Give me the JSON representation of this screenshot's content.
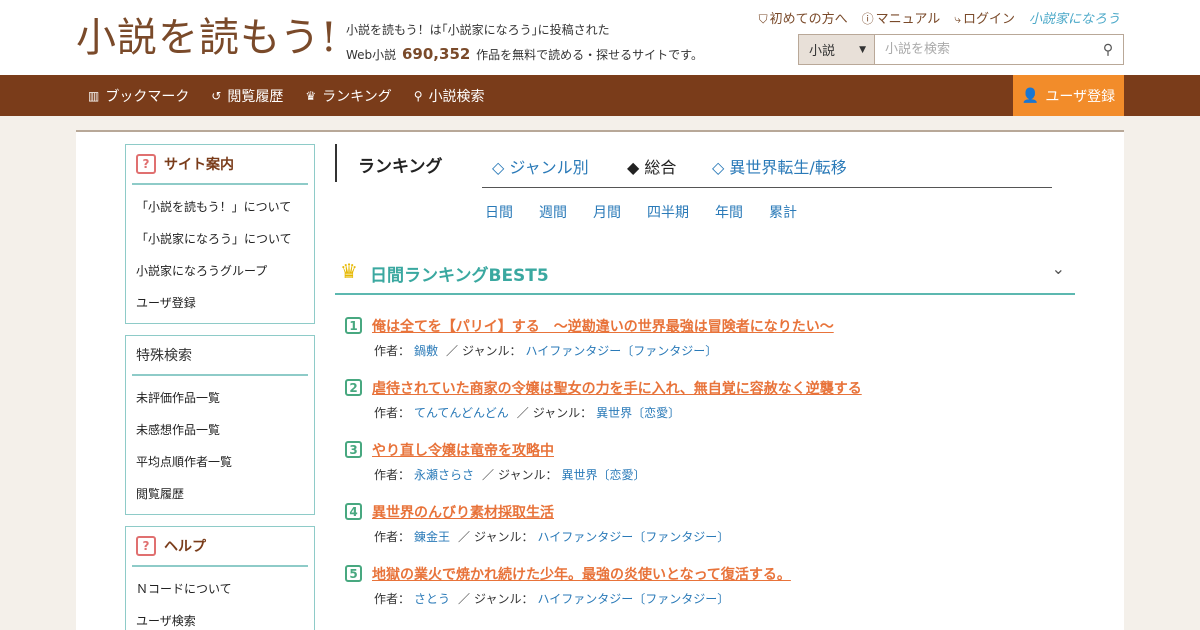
{
  "header": {
    "logo": "小説を読もう!",
    "tagline_line1": "小説を読もう！は｢小説家になろう｣に投稿された",
    "tagline_prefix": "Web小説",
    "work_count": "690,352",
    "tagline_suffix": "作品を無料で読める・探せるサイトです。",
    "links": [
      {
        "label": "初めての方へ",
        "icon": "shield-icon"
      },
      {
        "label": "マニュアル",
        "icon": "question-circle-icon"
      },
      {
        "label": "ログイン",
        "icon": "login-icon"
      }
    ],
    "brand": "小説家になろう",
    "search": {
      "select_value": "小説",
      "placeholder": "小説を検索"
    }
  },
  "nav": {
    "items": [
      {
        "label": "ブックマーク",
        "icon": "bookmark-icon"
      },
      {
        "label": "閲覧履歴",
        "icon": "history-icon"
      },
      {
        "label": "ランキング",
        "icon": "crown-icon"
      },
      {
        "label": "小説検索",
        "icon": "search-icon"
      }
    ],
    "register": "ユーザ登録"
  },
  "sidebar": {
    "boxes": [
      {
        "title": "サイト案内",
        "items": [
          "「小説を読もう！」について",
          "「小説家になろう」について",
          "小説家になろうグループ",
          "ユーザ登録"
        ]
      },
      {
        "title": "特殊検索",
        "items": [
          "未評価作品一覧",
          "未感想作品一覧",
          "平均点順作者一覧",
          "閲覧履歴"
        ]
      },
      {
        "title": "ヘルプ",
        "items": [
          "Ｎコードについて",
          "ユーザ検索"
        ]
      }
    ]
  },
  "main": {
    "tabs": {
      "title": "ランキング",
      "items": [
        {
          "label": "◇ ジャンル別",
          "active": false
        },
        {
          "label": "◆ 総合",
          "active": true
        },
        {
          "label": "◇ 異世界転生/転移",
          "active": false
        }
      ]
    },
    "periods": [
      "日間",
      "週間",
      "月間",
      "四半期",
      "年間",
      "累計"
    ],
    "ranking": {
      "title": "日間ランキングBEST5",
      "author_label": "作者：",
      "genre_label": "ジャンル：",
      "separator": "／",
      "items": [
        {
          "rank": "1",
          "title": "俺は全てを【パリイ】する　〜逆勘違いの世界最強は冒険者になりたい〜",
          "author": "鍋敷",
          "genre": "ハイファンタジー〔ファンタジー〕"
        },
        {
          "rank": "2",
          "title": "虐待されていた商家の令嬢は聖女の力を手に入れ、無自覚に容赦なく逆襲する",
          "author": "てんてんどんどん",
          "genre": "異世界〔恋愛〕"
        },
        {
          "rank": "3",
          "title": "やり直し令嬢は竜帝を攻略中",
          "author": "永瀬さらさ",
          "genre": "異世界〔恋愛〕"
        },
        {
          "rank": "4",
          "title": "異世界のんびり素材採取生活",
          "author": "錬金王",
          "genre": "ハイファンタジー〔ファンタジー〕"
        },
        {
          "rank": "5",
          "title": "地獄の業火で焼かれ続けた少年。最強の炎使いとなって復活する。",
          "author": "さとう",
          "genre": "ハイファンタジー〔ファンタジー〕"
        }
      ]
    }
  }
}
